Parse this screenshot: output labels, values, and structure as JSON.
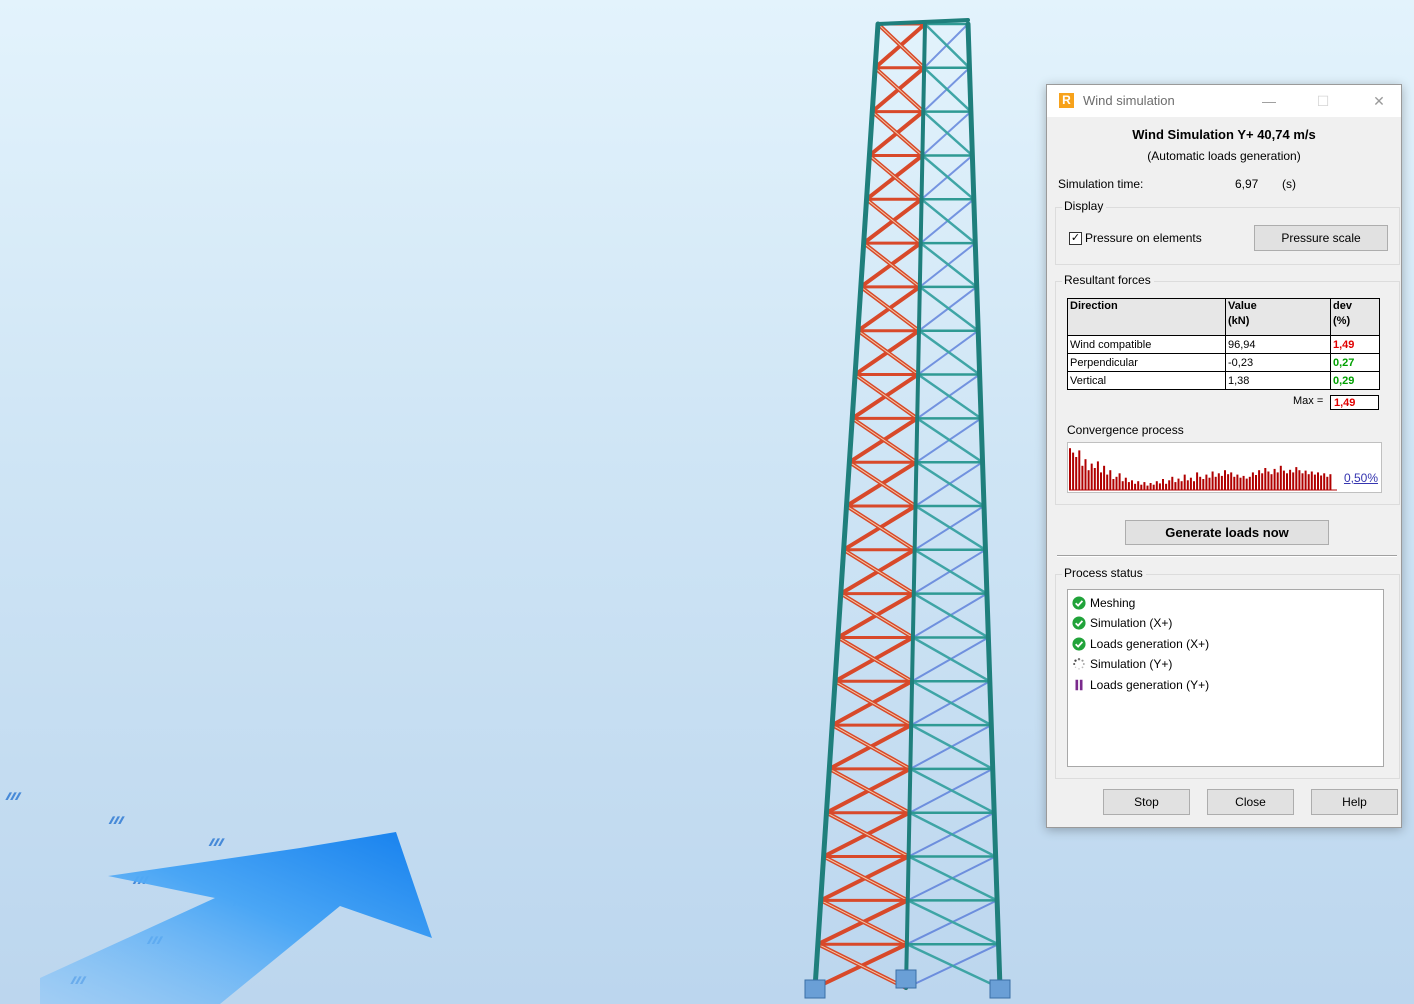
{
  "window": {
    "title": "Wind simulation",
    "icon_letter": "R",
    "minimize_glyph": "—",
    "maximize_glyph": "☐",
    "close_glyph": "✕"
  },
  "header": {
    "title": "Wind Simulation Y+ 40,74 m/s",
    "subtitle": "(Automatic loads generation)"
  },
  "simulation_time": {
    "label": "Simulation time:",
    "value": "6,97",
    "unit": "(s)"
  },
  "display": {
    "group_title": "Display",
    "pressure_checkbox_label": "Pressure on elements",
    "pressure_checked": true,
    "pressure_scale_button": "Pressure scale"
  },
  "resultant_forces": {
    "group_title": "Resultant forces",
    "columns": {
      "direction": "Direction",
      "value": "Value",
      "value_unit": "(kN)",
      "dev": "dev",
      "dev_unit": "(%)"
    },
    "rows": [
      {
        "direction": "Wind compatible",
        "value": "96,94",
        "dev": "1,49",
        "dev_color": "#e10000"
      },
      {
        "direction": "Perpendicular",
        "value": "-0,23",
        "dev": "0,27",
        "dev_color": "#00a000"
      },
      {
        "direction": "Vertical",
        "value": "1,38",
        "dev": "0,29",
        "dev_color": "#00a000"
      }
    ],
    "max_label": "Max =",
    "max_value": "1,49"
  },
  "convergence": {
    "label": "Convergence process",
    "current_value": "0,50%",
    "bar_color": "#b00000",
    "bar_values": [
      0.95,
      0.85,
      0.75,
      0.9,
      0.55,
      0.7,
      0.45,
      0.6,
      0.5,
      0.65,
      0.4,
      0.55,
      0.35,
      0.45,
      0.25,
      0.3,
      0.38,
      0.2,
      0.28,
      0.18,
      0.22,
      0.14,
      0.2,
      0.12,
      0.18,
      0.1,
      0.16,
      0.12,
      0.2,
      0.15,
      0.25,
      0.14,
      0.22,
      0.3,
      0.18,
      0.26,
      0.2,
      0.35,
      0.22,
      0.28,
      0.2,
      0.4,
      0.3,
      0.25,
      0.35,
      0.28,
      0.42,
      0.3,
      0.38,
      0.32,
      0.45,
      0.36,
      0.4,
      0.3,
      0.35,
      0.28,
      0.32,
      0.26,
      0.3,
      0.4,
      0.34,
      0.45,
      0.38,
      0.5,
      0.42,
      0.36,
      0.48,
      0.4,
      0.55,
      0.44,
      0.38,
      0.46,
      0.4,
      0.52,
      0.45,
      0.38,
      0.44,
      0.36,
      0.42,
      0.35,
      0.4,
      0.33,
      0.38,
      0.3,
      0.36
    ]
  },
  "generate_button": "Generate loads now",
  "process_status": {
    "group_title": "Process status",
    "items": [
      {
        "label": "Meshing",
        "state": "done",
        "icon": "check-icon"
      },
      {
        "label": "Simulation (X+)",
        "state": "done",
        "icon": "check-icon"
      },
      {
        "label": "Loads generation (X+)",
        "state": "done",
        "icon": "check-icon"
      },
      {
        "label": "Simulation (Y+)",
        "state": "running",
        "icon": "spinner-icon"
      },
      {
        "label": "Loads generation (Y+)",
        "state": "paused",
        "icon": "pause-icon"
      }
    ]
  },
  "footer": {
    "stop": "Stop",
    "close": "Close",
    "help": "Help"
  },
  "scene": {
    "wind_arrow_color": "#1e8cf0",
    "tower_chord_color": "#1f7f7c",
    "tower_brace_color": "#d8492a",
    "direction_marks": "ııı"
  }
}
